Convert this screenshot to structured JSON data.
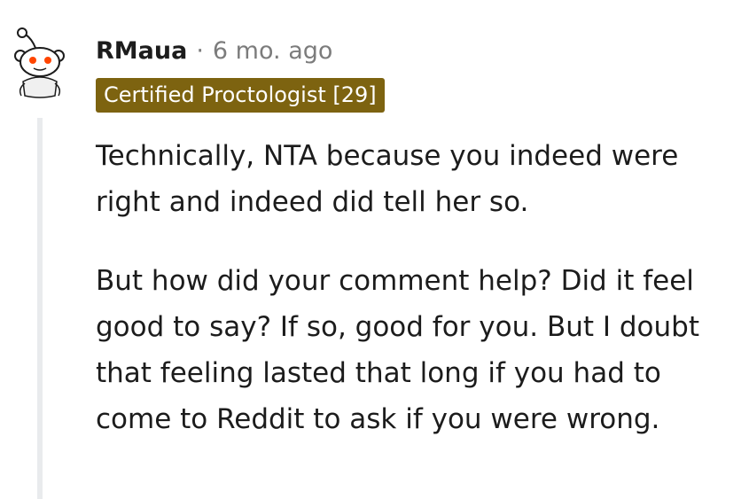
{
  "comment": {
    "author": "RMaua",
    "separator": "·",
    "time": "6 mo. ago",
    "flair": "Certified Proctologist [29]",
    "paragraphs": [
      "Technically, NTA because you indeed were right and indeed did tell her so.",
      "But how did your comment help? Did it feel good to say? If so, good for you. But I doubt that feeling lasted that long if you had to come to Reddit to ask if you were wrong."
    ]
  },
  "colors": {
    "flair_bg": "#7d6310",
    "flair_text": "#ffffff",
    "meta_gray": "#7c7c7c",
    "thread_line": "#e9ebed",
    "avatar_eye": "#ff4500"
  },
  "icons": {
    "avatar": "snoo-avatar-icon"
  }
}
